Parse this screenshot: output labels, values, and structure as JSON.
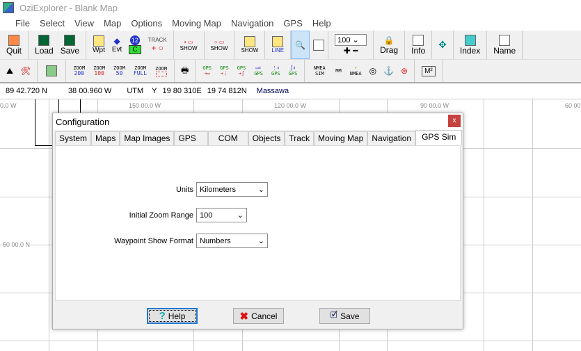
{
  "window": {
    "title": "OziExplorer - Blank Map"
  },
  "menu": [
    "File",
    "Select",
    "View",
    "Map",
    "Options",
    "Moving Map",
    "Navigation",
    "GPS",
    "Help"
  ],
  "toolbar1": {
    "quit": "Quit",
    "load": "Load",
    "save": "Save",
    "wpt": "Wpt",
    "evt": "Evt",
    "track": "TRACK",
    "show": "SHOW",
    "line": "LINE",
    "zoom_value": "100",
    "drag": "Drag",
    "info": "Info",
    "index": "Index",
    "name": "Name",
    "wp_num": "12",
    "c": "C"
  },
  "toolbar2": {
    "zoom_items": [
      {
        "top": "ZOOM",
        "bottom": "200"
      },
      {
        "top": "ZOOM",
        "bottom": "100"
      },
      {
        "top": "ZOOM",
        "bottom": "50"
      },
      {
        "top": "ZOOM",
        "bottom": "FULL"
      },
      {
        "top": "ZOOM",
        "bottom": ""
      }
    ],
    "gps_items": [
      "GPS",
      "GPS",
      "GPS",
      "GPS",
      "GPS",
      "GPS"
    ],
    "nmea_sim": "NMEA SIM",
    "mm": "MM",
    "nmea": "NMEA",
    "m2": "M²"
  },
  "status": {
    "lat": "89 42.720 N",
    "lon": "38 00.960 W",
    "grid": "UTM",
    "zone": "Y",
    "easting": "19 80 310E",
    "northing": "19 74 812N",
    "place": "Massawa"
  },
  "map": {
    "labels_x": [
      "0.0 W",
      "150 00.0 W",
      "120 00.0 W",
      "90 00.0 W",
      "60 00"
    ],
    "label_y": "60 00.0 N"
  },
  "dialog": {
    "title": "Configuration",
    "close": "x",
    "tabs": [
      "System",
      "Maps",
      "Map Images",
      "GPS",
      "COM",
      "Objects",
      "Track",
      "Moving Map",
      "Navigation",
      "GPS Sim"
    ],
    "active_tab": "GPS Sim",
    "fields": [
      {
        "label": "Units",
        "value": "Kilometers"
      },
      {
        "label": "Initial Zoom Range",
        "value": "100"
      },
      {
        "label": "Waypoint Show Format",
        "value": "Numbers"
      }
    ],
    "buttons": {
      "help": "Help",
      "cancel": "Cancel",
      "save": "Save"
    }
  }
}
